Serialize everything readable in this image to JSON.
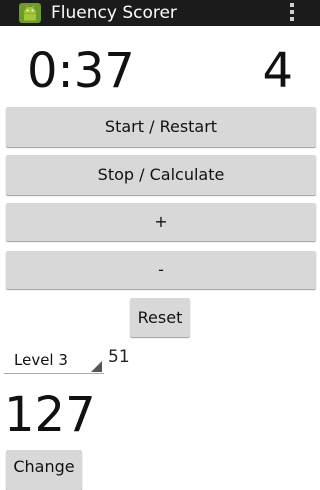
{
  "action_bar": {
    "title": "Fluency Scorer",
    "app_icon": "android-app-icon",
    "overflow_icon": "overflow-menu-icon"
  },
  "timer": {
    "value": "0:37"
  },
  "counter": {
    "value": "4"
  },
  "buttons": {
    "start_restart": "Start / Restart",
    "stop_calculate": "Stop / Calculate",
    "plus": "+",
    "minus": "-",
    "reset": "Reset"
  },
  "level": {
    "selected": "Level 3",
    "value": "51"
  },
  "score": {
    "value": "127"
  },
  "change_button": "Change",
  "colors": {
    "action_bar_bg": "#1b1b1b",
    "button_bg": "#d8d8d8",
    "background": "#ffffff"
  }
}
